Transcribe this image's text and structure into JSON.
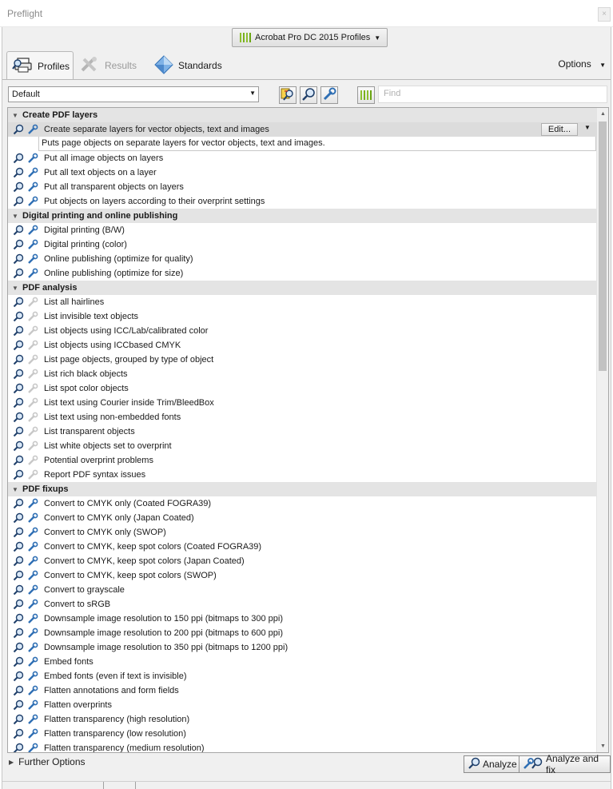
{
  "window": {
    "title": "Preflight",
    "close_glyph": "×"
  },
  "profile_library": {
    "label": "Acrobat Pro DC 2015 Profiles",
    "caret": "▼"
  },
  "tabs": [
    {
      "label": "Profiles",
      "icon": "magnifier-printer-icon"
    },
    {
      "label": "Results",
      "icon": "wrench-tools-icon"
    },
    {
      "label": "Standards",
      "icon": "diamond-icon"
    }
  ],
  "options": {
    "label": "Options",
    "caret": "▼"
  },
  "toolbar": {
    "filter_value": "Default",
    "filter_caret": "▼",
    "find_placeholder": "Find",
    "icons": [
      "select-profiles-icon",
      "magnifier-icon",
      "wrench-icon",
      "library-bars-icon"
    ]
  },
  "list": {
    "sections": [
      {
        "title": "Create PDF layers",
        "items": [
          {
            "label": "Create separate layers for vector objects, text and images",
            "fixup": true,
            "selected": true,
            "description": "Puts page objects on separate layers for vector objects, text and images.",
            "edit_label": "Edit..."
          },
          {
            "label": "Put all image objects on layers",
            "fixup": true
          },
          {
            "label": "Put all text objects on a layer",
            "fixup": true
          },
          {
            "label": "Put all transparent objects on layers",
            "fixup": true
          },
          {
            "label": "Put objects on layers according to their overprint settings",
            "fixup": true
          }
        ]
      },
      {
        "title": "Digital printing and online publishing",
        "items": [
          {
            "label": "Digital printing (B/W)",
            "fixup": true
          },
          {
            "label": "Digital printing (color)",
            "fixup": true
          },
          {
            "label": "Online publishing (optimize for quality)",
            "fixup": true
          },
          {
            "label": "Online publishing (optimize for size)",
            "fixup": true
          }
        ]
      },
      {
        "title": "PDF analysis",
        "items": [
          {
            "label": "List all hairlines",
            "fixup": false
          },
          {
            "label": "List invisible text objects",
            "fixup": false
          },
          {
            "label": "List objects using ICC/Lab/calibrated color",
            "fixup": false
          },
          {
            "label": "List objects using ICCbased CMYK",
            "fixup": false
          },
          {
            "label": "List page objects, grouped by type of object",
            "fixup": false
          },
          {
            "label": "List rich black objects",
            "fixup": false
          },
          {
            "label": "List spot color objects",
            "fixup": false
          },
          {
            "label": "List text using Courier inside Trim/BleedBox",
            "fixup": false
          },
          {
            "label": "List text using non-embedded fonts",
            "fixup": false
          },
          {
            "label": "List transparent objects",
            "fixup": false
          },
          {
            "label": "List white objects set to overprint",
            "fixup": false
          },
          {
            "label": "Potential overprint problems",
            "fixup": false
          },
          {
            "label": "Report PDF syntax issues",
            "fixup": false
          }
        ]
      },
      {
        "title": "PDF fixups",
        "items": [
          {
            "label": "Convert to CMYK only (Coated FOGRA39)",
            "fixup": true
          },
          {
            "label": "Convert to CMYK only (Japan Coated)",
            "fixup": true
          },
          {
            "label": "Convert to CMYK only (SWOP)",
            "fixup": true
          },
          {
            "label": "Convert to CMYK, keep spot colors (Coated FOGRA39)",
            "fixup": true
          },
          {
            "label": "Convert to CMYK, keep spot colors (Japan Coated)",
            "fixup": true
          },
          {
            "label": "Convert to CMYK, keep spot colors (SWOP)",
            "fixup": true
          },
          {
            "label": "Convert to grayscale",
            "fixup": true
          },
          {
            "label": "Convert to sRGB",
            "fixup": true
          },
          {
            "label": "Downsample image resolution to 150 ppi (bitmaps to 300 ppi)",
            "fixup": true
          },
          {
            "label": "Downsample image resolution to 200 ppi (bitmaps to 600 ppi)",
            "fixup": true
          },
          {
            "label": "Downsample image resolution to 350 ppi (bitmaps to 1200 ppi)",
            "fixup": true
          },
          {
            "label": "Embed fonts",
            "fixup": true
          },
          {
            "label": "Embed fonts (even if text is invisible)",
            "fixup": true
          },
          {
            "label": "Flatten annotations and form fields",
            "fixup": true
          },
          {
            "label": "Flatten overprints",
            "fixup": true
          },
          {
            "label": "Flatten transparency (high resolution)",
            "fixup": true
          },
          {
            "label": "Flatten transparency (low resolution)",
            "fixup": true
          },
          {
            "label": "Flatten transparency (medium resolution)",
            "fixup": true
          }
        ]
      }
    ]
  },
  "footer": {
    "further_options": "Further Options",
    "analyze_label": "Analyze",
    "analyze_fix_label": "Analyze and fix"
  },
  "colors": {
    "accent_green": "#7ab11d",
    "icon_blue": "#2f6fb4",
    "section_bg": "#e4e4e4"
  }
}
